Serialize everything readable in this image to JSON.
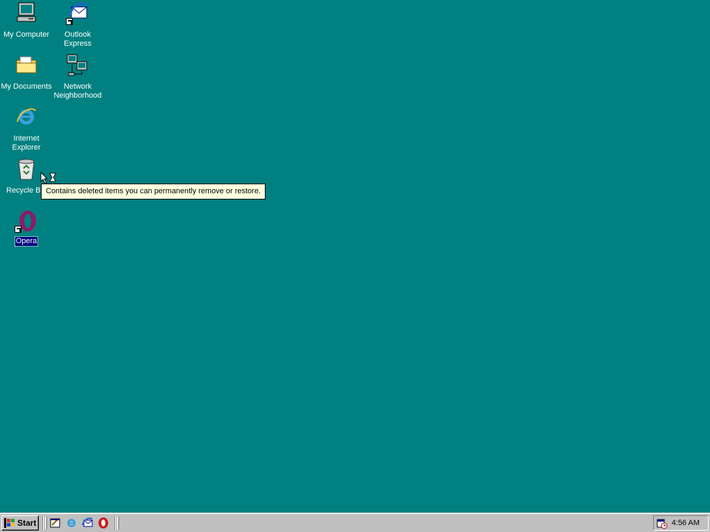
{
  "desktop": {
    "icons": [
      {
        "label": "My Computer",
        "icon": "computer-icon"
      },
      {
        "label": "Outlook Express",
        "icon": "outlook-express-icon",
        "shortcut": true
      },
      {
        "label": "My Documents",
        "icon": "folder-icon"
      },
      {
        "label": "Network Neighborhood",
        "icon": "network-icon"
      },
      {
        "label": "Internet Explorer",
        "icon": "internet-explorer-icon"
      },
      {
        "label": "Recycle B",
        "icon": "recycle-bin-icon"
      },
      {
        "label": "Opera",
        "icon": "opera-icon",
        "shortcut": true,
        "selected": true
      }
    ],
    "tooltip": "Contains deleted items you can permanently remove or restore.",
    "background_color": "#008080"
  },
  "taskbar": {
    "start_label": "Start",
    "quick_launch": [
      "show-desktop-icon",
      "internet-explorer-icon",
      "outlook-express-icon",
      "opera-icon"
    ],
    "clock": "4:56 AM",
    "tray_icon": "task-scheduler-icon"
  }
}
